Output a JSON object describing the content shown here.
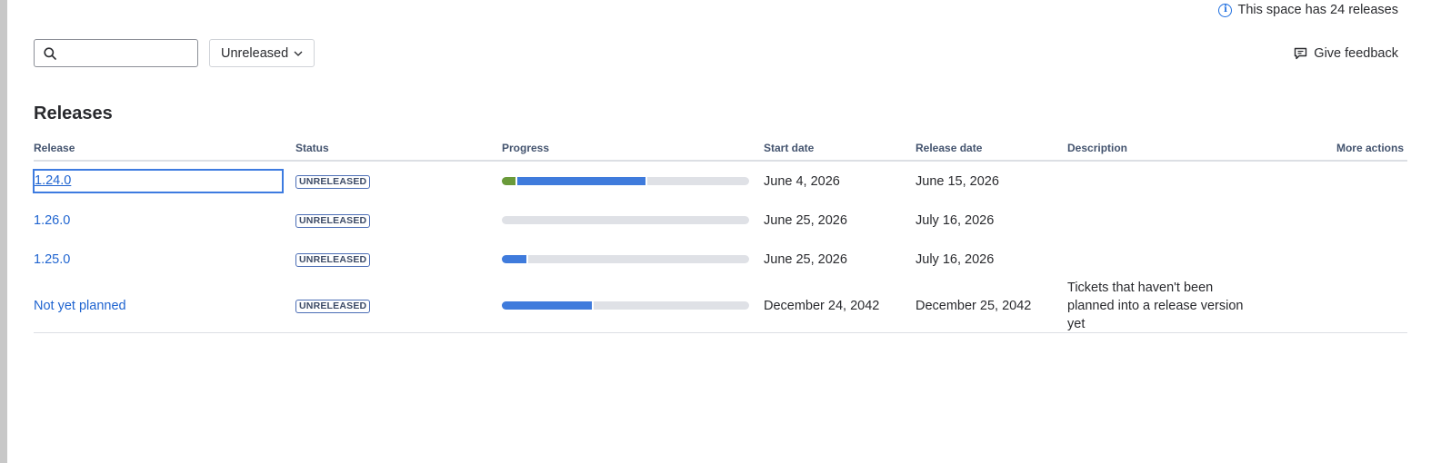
{
  "banner": {
    "text": "This space has 24 releases",
    "icon": "info-icon"
  },
  "toolbar": {
    "search_value": "",
    "search_icon": "search-icon",
    "filter_label": "Unreleased",
    "feedback_label": "Give feedback",
    "feedback_icon": "feedback-icon"
  },
  "section_title": "Releases",
  "table": {
    "headers": {
      "release": "Release",
      "status": "Status",
      "progress": "Progress",
      "start_date": "Start date",
      "release_date": "Release date",
      "description": "Description",
      "more_actions": "More actions"
    },
    "rows": [
      {
        "release": "1.24.0",
        "status": "UNRELEASED",
        "done_pct": 0.055,
        "inprogress_pct": 0.52,
        "start": "June 4, 2026",
        "release_date": "June 15, 2026",
        "description": ""
      },
      {
        "release": "1.26.0",
        "status": "UNRELEASED",
        "done_pct": 0,
        "inprogress_pct": 0,
        "start": "June 25, 2026",
        "release_date": "July 16, 2026",
        "description": ""
      },
      {
        "release": "1.25.0",
        "status": "UNRELEASED",
        "done_pct": 0,
        "inprogress_pct": 0.1,
        "start": "June 25, 2026",
        "release_date": "July 16, 2026",
        "description": ""
      },
      {
        "release": "Not yet planned",
        "status": "UNRELEASED",
        "done_pct": 0,
        "inprogress_pct": 0.365,
        "start": "December 24, 2042",
        "release_date": "December 25, 2042",
        "description": "Tickets that haven't been planned into a release version yet"
      }
    ]
  },
  "colors": {
    "done": "#6a9a3a",
    "in_progress": "#3f7bdc",
    "todo": "#dfe1e6",
    "link": "#1f64d0"
  }
}
